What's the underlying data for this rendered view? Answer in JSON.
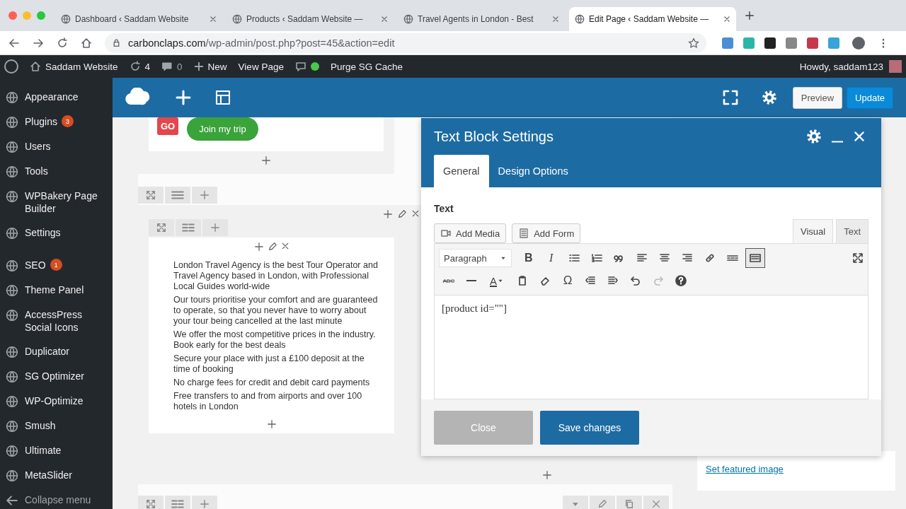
{
  "browser": {
    "tabs": [
      {
        "title": "Dashboard ‹ Saddam Website",
        "selected": false
      },
      {
        "title": "Products ‹ Saddam Website —",
        "selected": false
      },
      {
        "title": "Travel Agents in London - Best",
        "selected": false
      },
      {
        "title": "Edit Page ‹ Saddam Website —",
        "selected": true
      }
    ],
    "url_host": "carbonclaps.com",
    "url_path": "/wp-admin/post.php?post=45&action=edit"
  },
  "admin_bar": {
    "site": "Saddam Website",
    "updates": "4",
    "comments": "0",
    "new": "New",
    "view_page": "View Page",
    "purge": "Purge SG Cache",
    "greeting": "Howdy, saddam123"
  },
  "sidebar": {
    "items": [
      {
        "label": "Appearance"
      },
      {
        "label": "Plugins",
        "badge": "3"
      },
      {
        "label": "Users"
      },
      {
        "label": "Tools"
      },
      {
        "label": "WPBakery Page Builder"
      },
      {
        "label": "Settings"
      },
      {
        "label": "SEO",
        "badge": "1"
      },
      {
        "label": "Theme Panel"
      },
      {
        "label": "AccessPress Social Icons"
      },
      {
        "label": "Duplicator"
      },
      {
        "label": "SG Optimizer"
      },
      {
        "label": "WP-Optimize"
      },
      {
        "label": "Smush"
      },
      {
        "label": "Ultimate"
      },
      {
        "label": "MetaSlider"
      }
    ],
    "collapse": "Collapse menu"
  },
  "builder": {
    "preview": "Preview",
    "update": "Update",
    "go_badge": "GO",
    "join_button": "Join my trip",
    "text_items": [
      "London Travel Agency is the best Tour Operator and Travel Agency based in London, with Professional Local Guides world-wide",
      "Our tours prioritise your comfort and are guaranteed to operate, so that you never have to worry about your tour being cancelled at the last minute",
      "We offer the most competitive prices in the industry. Book early for the best deals",
      "Secure your place with just a £100 deposit at the time of booking",
      "No charge fees for credit and debit card payments",
      "Free transfers to and from airports and over 100 hotels in London"
    ],
    "featured_link": "Set featured image"
  },
  "modal": {
    "title": "Text Block Settings",
    "tabs": [
      {
        "label": "General",
        "selected": true
      },
      {
        "label": "Design Options",
        "selected": false
      }
    ],
    "field_label": "Text",
    "add_media": "Add Media",
    "add_form": "Add Form",
    "editor_tabs": [
      {
        "label": "Visual",
        "selected": true
      },
      {
        "label": "Text",
        "selected": false
      }
    ],
    "format": "Paragraph",
    "toolbar_row1": [
      {
        "kind": "bold",
        "label": "B",
        "pressed": false
      },
      {
        "kind": "italic",
        "label": "I",
        "pressed": false
      },
      {
        "kind": "bullet-list",
        "pressed": false
      },
      {
        "kind": "numbered-list",
        "pressed": false
      },
      {
        "kind": "quote",
        "pressed": false
      },
      {
        "kind": "align-left",
        "pressed": false
      },
      {
        "kind": "align-center",
        "pressed": false
      },
      {
        "kind": "align-right",
        "pressed": false
      },
      {
        "kind": "link",
        "pressed": false
      },
      {
        "kind": "read-more",
        "pressed": false
      },
      {
        "kind": "toolbar-toggle",
        "pressed": true
      }
    ],
    "toolbar_row2": [
      {
        "kind": "strikethrough",
        "label": "ABC",
        "disabled": false
      },
      {
        "kind": "horizontal-line",
        "disabled": false
      },
      {
        "kind": "text-color",
        "label": "A",
        "disabled": false
      },
      {
        "kind": "paste",
        "disabled": false
      },
      {
        "kind": "eraser",
        "disabled": false
      },
      {
        "kind": "special-char",
        "label": "Ω",
        "disabled": false
      },
      {
        "kind": "outdent",
        "disabled": false
      },
      {
        "kind": "indent",
        "disabled": false
      },
      {
        "kind": "undo",
        "disabled": false
      },
      {
        "kind": "redo",
        "disabled": true
      },
      {
        "kind": "help",
        "disabled": false
      }
    ],
    "content": "[product id=\"\"]",
    "close": "Close",
    "save": "Save changes"
  }
}
